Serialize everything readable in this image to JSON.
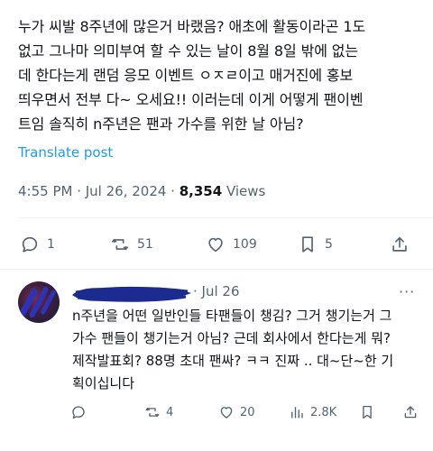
{
  "post": {
    "text_lines": [
      "누가 씨발 8주년에 많은거 바랬음? 애초에 활동이라곤 1도",
      "없고 그나마 의미부여 할 수 있는 날이 8월 8일 밖에 없는",
      "데 한다는게 랜덤 응모 이벤트 ㅇㅈㄹ이고 매거진에 홍보",
      "띄우면서 전부 다~ 오세요!! 이러는데 이게 어떻게 팬이벤",
      "트임 솔직히 n주년은 팬과 가수를 위한 날 아님?"
    ],
    "translate_label": "Translate post",
    "timestamp": "4:55 PM · Jul 26, 2024 · ",
    "views_count": "8,354",
    "views_label": " Views",
    "actions": {
      "replies": "1",
      "reposts": "51",
      "likes": "109",
      "bookmarks": "5"
    }
  },
  "reply": {
    "handle_date": "· Jul 26",
    "more_label": "···",
    "text_lines": [
      "n주년을 어떤 일반인들 타팬들이 챙김? 그거 챙기는거 그",
      "가수 팬들이 챙기는거 아님? 근데 회사에서 한다는게 뭐?",
      "제작발표회? 88명 초대 팬싸? ㅋㅋ 진짜 .. 대~단~한 기",
      "획이십니다"
    ],
    "actions": {
      "reposts": "4",
      "likes": "20",
      "views": "2.8K"
    }
  },
  "colors": {
    "text": "#0f1419",
    "secondary": "#536471",
    "link": "#1d9bf0",
    "redaction": "#1c2b8f"
  },
  "icons": [
    "reply-icon",
    "repost-icon",
    "like-icon",
    "bookmark-icon",
    "share-icon",
    "views-icon"
  ]
}
